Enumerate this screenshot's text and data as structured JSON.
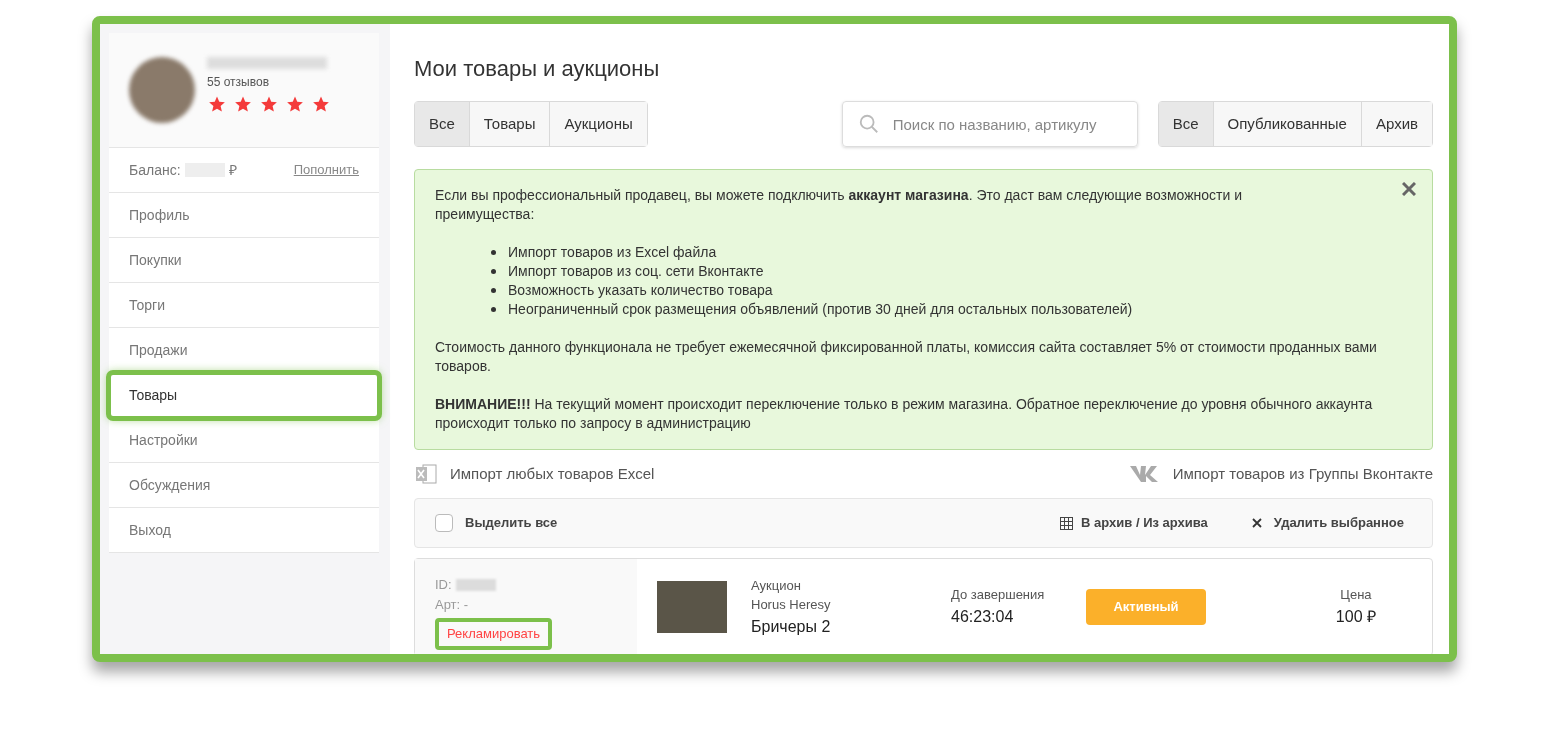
{
  "profile": {
    "reviews": "55 отзывов",
    "stars": 5
  },
  "balance": {
    "label": "Баланс:",
    "currency": "₽",
    "action": "Пополнить"
  },
  "sidebar": {
    "items": [
      {
        "label": "Профиль",
        "highlighted": false
      },
      {
        "label": "Покупки",
        "highlighted": false
      },
      {
        "label": "Торги",
        "highlighted": false
      },
      {
        "label": "Продажи",
        "highlighted": false
      },
      {
        "label": "Товары",
        "highlighted": true
      },
      {
        "label": "Настройки",
        "highlighted": false
      },
      {
        "label": "Обсуждения",
        "highlighted": false
      },
      {
        "label": "Выход",
        "highlighted": false
      }
    ]
  },
  "title": "Мои товары и аукционы",
  "type_tabs": [
    {
      "label": "Все",
      "selected": true
    },
    {
      "label": "Товары",
      "selected": false
    },
    {
      "label": "Аукционы",
      "selected": false
    }
  ],
  "search": {
    "placeholder": "Поиск по названию, артикулу"
  },
  "status_tabs": [
    {
      "label": "Все",
      "selected": true
    },
    {
      "label": "Опубликованные",
      "selected": false
    },
    {
      "label": "Архив",
      "selected": false
    }
  ],
  "notice": {
    "intro": "Если вы профессиональный продавец, вы можете подключить **аккаунт магазина**. Это даст вам следующие возможности и преимущества:",
    "bullets": [
      "Импорт товаров из Excel файла",
      "Импорт товаров из соц. сети Вконтакте",
      "Возможность указать количество товара",
      "Неограниченный срок размещения объявлений (против 30 дней для остальных пользователей)"
    ],
    "cost": "Стоимость данного функционала не требует ежемесячной фиксированной платы, комиссия сайта составляет 5% от стоимости проданных вами товаров.",
    "warning": "**ВНИМАНИЕ!!!** На текущий момент происходит переключение только в режим магазина. Обратное переключение до уровня обычного аккаунта происходит только по запросу в администрацию"
  },
  "import_excel": "Импорт любых товаров Excel",
  "import_vk": "Импорт товаров из Группы Вконтакте",
  "toolbar": {
    "select_all": {
      "label": "Выделить все",
      "checked": false
    },
    "archive": "В архив / Из архива",
    "delete": "Удалить выбранное"
  },
  "items": [
    {
      "id_label": "ID:",
      "art": "Арт: -",
      "promote": "Рекламировать",
      "promote_highlighted": true,
      "type": "Аукцион",
      "category": "Horus Heresy",
      "name": "Бричеры 2",
      "ends_label": "До завершения",
      "ends": "46:23:04",
      "status": "Активный",
      "price_label": "Цена",
      "price": "100 ₽"
    }
  ]
}
